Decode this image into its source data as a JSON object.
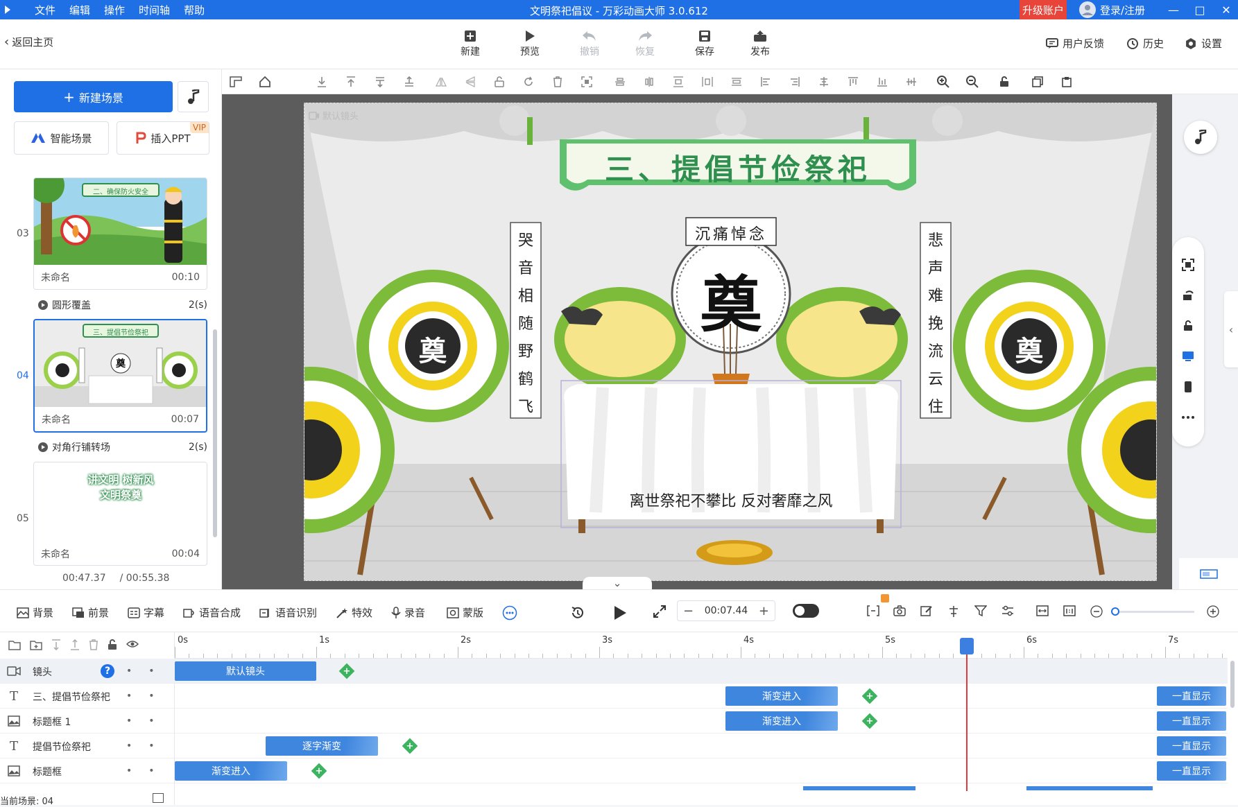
{
  "titlebar": {
    "menu": [
      "文件",
      "编辑",
      "操作",
      "时间轴",
      "帮助"
    ],
    "window_title": "文明祭祀倡议 - 万彩动画大师 3.0.612",
    "upgrade": "升级账户",
    "login": "登录/注册"
  },
  "toolbar": {
    "back": "返回主页",
    "buttons": {
      "new": "新建",
      "preview": "预览",
      "undo": "撤销",
      "redo": "恢复",
      "save": "保存",
      "publish": "发布"
    },
    "feedback": "用户反馈",
    "history": "历史",
    "settings": "设置"
  },
  "left": {
    "new_scene": "新建场景",
    "smart_scene": "智能场景",
    "insert_ppt": "插入PPT",
    "vip": "VIP",
    "scenes": [
      {
        "num": "03",
        "name": "未命名",
        "duration": "00:10",
        "thumb_title": "二、确保防火安全"
      },
      {
        "num": "04",
        "name": "未命名",
        "duration": "00:07",
        "thumb_title": "三、提倡节俭祭祀"
      },
      {
        "num": "05",
        "name": "未命名",
        "duration": "00:04",
        "thumb_lines": [
          "讲文明 树新风",
          "文明祭奠"
        ]
      }
    ],
    "transitions": [
      {
        "name": "圆形覆盖",
        "duration": "2(s)"
      },
      {
        "name": "对角行铺转场",
        "duration": "2(s)"
      }
    ],
    "time_current": "00:47.37",
    "time_total": "/ 00:55.38"
  },
  "stage": {
    "camera_label": "默认镜头",
    "title": "三、提倡节俭祭祀",
    "subtitle": "沉痛悼念",
    "left_couplet": [
      "哭",
      "音",
      "相",
      "随",
      "野",
      "鹤",
      "飞"
    ],
    "right_couplet": [
      "悲",
      "声",
      "难",
      "挽",
      "流",
      "云",
      "住"
    ],
    "center_char": "奠",
    "caption": "离世祭祀不攀比 反对奢靡之风"
  },
  "bottom": {
    "background": "背景",
    "foreground": "前景",
    "subtitle": "字幕",
    "tts": "语音合成",
    "asr": "语音识别",
    "effects": "特效",
    "record": "录音",
    "mask": "蒙版",
    "time": "00:07.44"
  },
  "timeline": {
    "ticks": [
      "0s",
      "1s",
      "2s",
      "3s",
      "4s",
      "5s",
      "6s",
      "7s"
    ],
    "rows": [
      {
        "name": "镜头",
        "clips": [
          {
            "label": "默认镜头"
          }
        ]
      },
      {
        "name": "三、提倡节俭祭祀",
        "clips": [
          {
            "label": "渐变进入"
          },
          {
            "label": "一直显示"
          }
        ]
      },
      {
        "name": "标题框 1",
        "clips": [
          {
            "label": "渐变进入"
          },
          {
            "label": "一直显示"
          }
        ]
      },
      {
        "name": "提倡节俭祭祀",
        "clips": [
          {
            "label": "逐字渐变"
          },
          {
            "label": "一直显示"
          }
        ]
      },
      {
        "name": "标题框",
        "clips": [
          {
            "label": "渐变进入"
          },
          {
            "label": "一直显示"
          }
        ]
      }
    ],
    "status": "当前场景: 04"
  },
  "colors": {
    "accent": "#1f6fe5",
    "clip": "#3f86de",
    "keyframe": "#3cb35f",
    "playhead": "#e03a3a",
    "title_green": "#2f8f4e"
  }
}
